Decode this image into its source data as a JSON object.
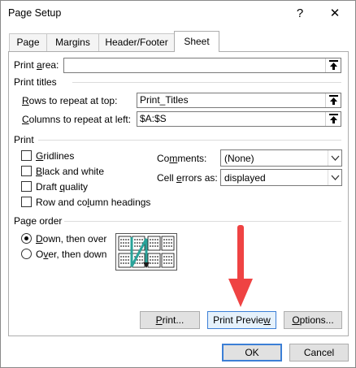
{
  "window": {
    "title": "Page Setup",
    "help_glyph": "?",
    "close_glyph": "✕"
  },
  "tabs": [
    "Page",
    "Margins",
    "Header/Footer",
    "Sheet"
  ],
  "active_tab": "Sheet",
  "print_area": {
    "label_u": "a",
    "label_pre": "Print ",
    "label_post": "rea:",
    "value": ""
  },
  "print_titles": {
    "heading": "Print titles",
    "rows_label_u": "R",
    "rows_label_rest": "ows to repeat at top:",
    "rows_value": "Print_Titles",
    "cols_label_u": "C",
    "cols_label_rest": "olumns to repeat at left:",
    "cols_value": "$A:$S"
  },
  "print": {
    "heading": "Print",
    "gridlines": {
      "u": "G",
      "rest": "ridlines",
      "checked": false
    },
    "black_white": {
      "u": "B",
      "rest": "lack and white",
      "checked": false
    },
    "draft": {
      "pre": "Draft ",
      "u": "q",
      "rest": "uality",
      "checked": false
    },
    "row_col_headings": {
      "pre": "Row and co",
      "u": "l",
      "rest": "umn headings",
      "checked": false
    },
    "comments_label_pre": "Co",
    "comments_label_u": "m",
    "comments_label_rest": "ments:",
    "comments_value": "(None)",
    "cell_errors_label_pre": "Cell ",
    "cell_errors_label_u": "e",
    "cell_errors_label_rest": "rrors as:",
    "cell_errors_value": "displayed"
  },
  "page_order": {
    "heading": "Page order",
    "down_over": {
      "u": "D",
      "rest": "own, then over",
      "selected": true
    },
    "over_down": {
      "pre": "O",
      "u": "v",
      "rest": "er, then down",
      "selected": false
    }
  },
  "buttons": {
    "print": {
      "u": "P",
      "rest": "rint..."
    },
    "print_preview": {
      "pre": "Print Previe",
      "u": "w",
      "rest": ""
    },
    "options": {
      "u": "O",
      "rest": "ptions..."
    },
    "ok": "OK",
    "cancel": "Cancel"
  },
  "colors": {
    "accent": "#3c7fd6",
    "arrow": "#ef4343",
    "order_arrow": "#2aa39a"
  }
}
